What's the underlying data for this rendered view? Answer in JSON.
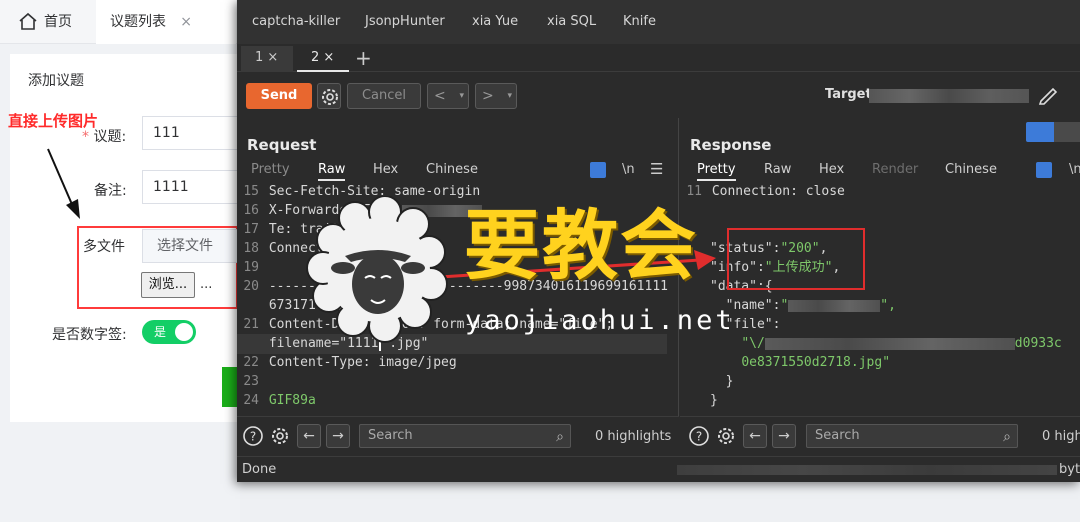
{
  "web": {
    "tabs": [
      {
        "label": "首页"
      },
      {
        "label": "议题列表",
        "close": "×"
      }
    ],
    "card_title": "添加议题",
    "annotation": "直接上传图片",
    "fields": {
      "topic": {
        "required_mark": "*",
        "label": "议题:",
        "value": "111"
      },
      "remark": {
        "label": "备注:",
        "value": "1111"
      },
      "multi_file": {
        "label": "多文件",
        "choose_button": "选择文件",
        "browse_button": "浏览...",
        "browse_dots": "..."
      },
      "digital_sign": {
        "label": "是否数字签:",
        "toggle_text": "是"
      }
    }
  },
  "burp": {
    "extension_tabs": [
      "captcha-killer",
      "JsonpHunter",
      "xia Yue",
      "xia SQL",
      "Knife"
    ],
    "repeater_tabs": [
      {
        "label": "1 ×"
      },
      {
        "label": "2 ×"
      }
    ],
    "repeater_plus": "+",
    "toolbar": {
      "send": "Send",
      "cancel": "Cancel",
      "prev": "<",
      "next": ">",
      "dropdown": "▾",
      "target_label": "Target:"
    },
    "request": {
      "title": "Request",
      "subtabs": [
        "Pretty",
        "Raw",
        "Hex",
        "Chinese"
      ],
      "newline_label": "\\n",
      "menu_label": "☰",
      "lines": [
        {
          "n": "15",
          "t": "Sec-Fetch-Site: same-origin"
        },
        {
          "n": "16",
          "t": "X-Forwarded-For: "
        },
        {
          "n": "17",
          "t": "Te: trailers"
        },
        {
          "n": "18",
          "t": "Connection: close"
        },
        {
          "n": "19",
          "t": ""
        },
        {
          "n": "20",
          "t": "------------------------------998734016119699161111"
        },
        {
          "n": "",
          "t": "67317168"
        },
        {
          "n": "21",
          "t": "Content-Disposition: form-data; name=\"file\";"
        },
        {
          "n": "",
          "t": "filename=\"1111",
          "t2": ".jpg\""
        },
        {
          "n": "22",
          "t": "Content-Type: image/jpeg"
        },
        {
          "n": "23",
          "t": ""
        },
        {
          "n": "24",
          "t": "GIF89a"
        }
      ],
      "search_placeholder": "Search",
      "highlights": "0 highlights"
    },
    "response": {
      "title": "Response",
      "subtabs": [
        "Pretty",
        "Raw",
        "Hex",
        "Render",
        "Chinese"
      ],
      "newline_label": "\\n",
      "lines": [
        {
          "n": "11",
          "t": "Connection: close"
        },
        {
          "n": "",
          "t": ""
        },
        {
          "n": "",
          "t": ""
        },
        {
          "n": "",
          "k": "\"status\":",
          "v": "\"200\"",
          "tail": ","
        },
        {
          "n": "",
          "k": "\"info\":",
          "v": "\"上传成功\"",
          "tail": ","
        },
        {
          "n": "",
          "k": "\"data\":",
          "v": "",
          "tail": "{"
        },
        {
          "n": "",
          "k": "  \"name\":",
          "v": "\"",
          "tail": "\","
        },
        {
          "n": "",
          "k": "  \"file\":",
          "v": "",
          "tail": ""
        },
        {
          "n": "",
          "k": "    ",
          "v": "\"\\/",
          "tail": "d0933c"
        },
        {
          "n": "",
          "k": "    ",
          "v": "0e8371550d2718.jpg\"",
          "tail": ""
        },
        {
          "n": "",
          "k": "  ",
          "v": "",
          "tail": "}"
        },
        {
          "n": "",
          "k": "",
          "v": "",
          "tail": "}"
        }
      ],
      "search_placeholder": "Search",
      "highlights": "0 high"
    },
    "status": {
      "left": "Done",
      "right": "byte"
    }
  },
  "watermark": {
    "chinese": "要教会",
    "url": "yaojiaohui.net"
  },
  "colors": {
    "send": "#e8672f",
    "accent_blue": "#3d7bd9",
    "annotation_red": "#ff2a2a",
    "toggle_green": "#13ce66",
    "json_string": "#7ec86a",
    "watermark_yellow": "#ffd21e"
  }
}
